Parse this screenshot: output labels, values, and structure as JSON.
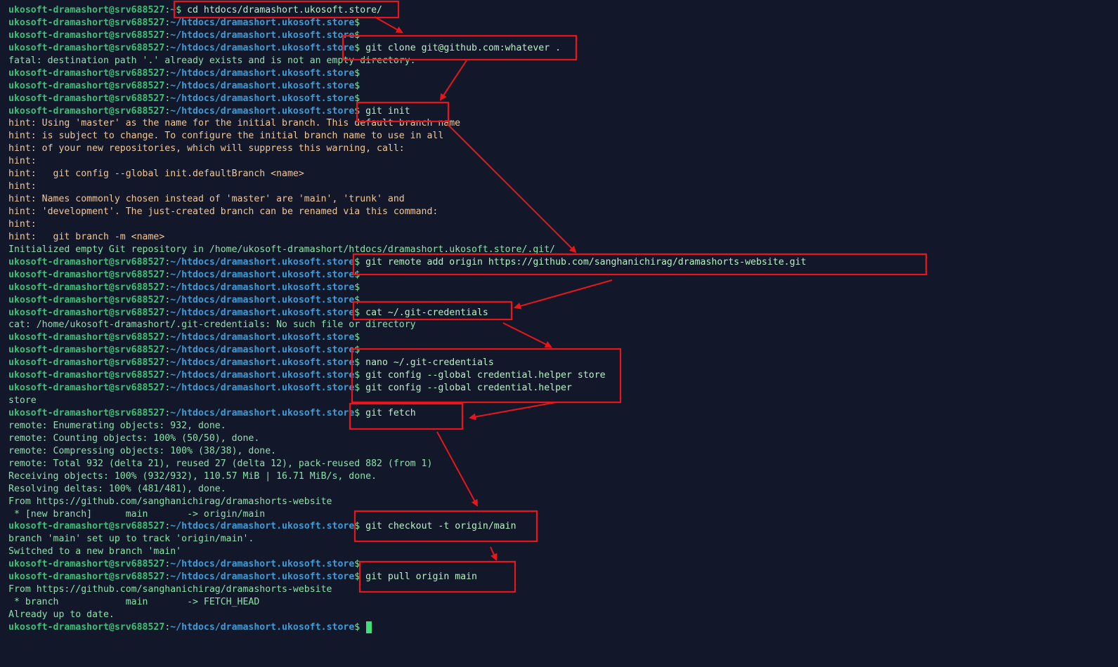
{
  "terminal": {
    "prompt": {
      "user": "ukosoft-dramashort@srv688527",
      "separator": ":",
      "dollar": "$",
      "home_path": "~",
      "project_path": "~/htdocs/dramashort.ukosoft.store"
    },
    "lines": [
      {
        "kind": "prompt",
        "path": "~",
        "cmd": " cd htdocs/dramashort.ukosoft.store/"
      },
      {
        "kind": "prompt",
        "path": "~/htdocs/dramashort.ukosoft.store",
        "cmd": ""
      },
      {
        "kind": "prompt",
        "path": "~/htdocs/dramashort.ukosoft.store",
        "cmd": ""
      },
      {
        "kind": "prompt",
        "path": "~/htdocs/dramashort.ukosoft.store",
        "cmd": " git clone git@github.com:whatever ."
      },
      {
        "kind": "out",
        "text": "fatal: destination path '.' already exists and is not an empty directory."
      },
      {
        "kind": "prompt",
        "path": "~/htdocs/dramashort.ukosoft.store",
        "cmd": ""
      },
      {
        "kind": "prompt",
        "path": "~/htdocs/dramashort.ukosoft.store",
        "cmd": ""
      },
      {
        "kind": "prompt",
        "path": "~/htdocs/dramashort.ukosoft.store",
        "cmd": ""
      },
      {
        "kind": "prompt",
        "path": "~/htdocs/dramashort.ukosoft.store",
        "cmd": " git init"
      },
      {
        "kind": "hint",
        "text": "hint: Using 'master' as the name for the initial branch. This default branch name"
      },
      {
        "kind": "hint",
        "text": "hint: is subject to change. To configure the initial branch name to use in all"
      },
      {
        "kind": "hint",
        "text": "hint: of your new repositories, which will suppress this warning, call:"
      },
      {
        "kind": "hint",
        "text": "hint:"
      },
      {
        "kind": "hint",
        "text": "hint:   git config --global init.defaultBranch <name>"
      },
      {
        "kind": "hint",
        "text": "hint:"
      },
      {
        "kind": "hint",
        "text": "hint: Names commonly chosen instead of 'master' are 'main', 'trunk' and"
      },
      {
        "kind": "hint",
        "text": "hint: 'development'. The just-created branch can be renamed via this command:"
      },
      {
        "kind": "hint",
        "text": "hint:"
      },
      {
        "kind": "hint",
        "text": "hint:   git branch -m <name>"
      },
      {
        "kind": "out",
        "text": "Initialized empty Git repository in /home/ukosoft-dramashort/htdocs/dramashort.ukosoft.store/.git/"
      },
      {
        "kind": "prompt",
        "path": "~/htdocs/dramashort.ukosoft.store",
        "cmd": " git remote add origin https://github.com/sanghanichirag/dramashorts-website.git"
      },
      {
        "kind": "prompt",
        "path": "~/htdocs/dramashort.ukosoft.store",
        "cmd": ""
      },
      {
        "kind": "prompt",
        "path": "~/htdocs/dramashort.ukosoft.store",
        "cmd": ""
      },
      {
        "kind": "prompt",
        "path": "~/htdocs/dramashort.ukosoft.store",
        "cmd": ""
      },
      {
        "kind": "prompt",
        "path": "~/htdocs/dramashort.ukosoft.store",
        "cmd": " cat ~/.git-credentials"
      },
      {
        "kind": "out",
        "text": "cat: /home/ukosoft-dramashort/.git-credentials: No such file or directory"
      },
      {
        "kind": "prompt",
        "path": "~/htdocs/dramashort.ukosoft.store",
        "cmd": ""
      },
      {
        "kind": "prompt",
        "path": "~/htdocs/dramashort.ukosoft.store",
        "cmd": ""
      },
      {
        "kind": "prompt",
        "path": "~/htdocs/dramashort.ukosoft.store",
        "cmd": " nano ~/.git-credentials"
      },
      {
        "kind": "prompt",
        "path": "~/htdocs/dramashort.ukosoft.store",
        "cmd": " git config --global credential.helper store"
      },
      {
        "kind": "prompt",
        "path": "~/htdocs/dramashort.ukosoft.store",
        "cmd": " git config --global credential.helper"
      },
      {
        "kind": "out",
        "text": "store"
      },
      {
        "kind": "prompt",
        "path": "~/htdocs/dramashort.ukosoft.store",
        "cmd": " git fetch"
      },
      {
        "kind": "out",
        "text": "remote: Enumerating objects: 932, done."
      },
      {
        "kind": "out",
        "text": "remote: Counting objects: 100% (50/50), done."
      },
      {
        "kind": "out",
        "text": "remote: Compressing objects: 100% (38/38), done."
      },
      {
        "kind": "out",
        "text": "remote: Total 932 (delta 21), reused 27 (delta 12), pack-reused 882 (from 1)"
      },
      {
        "kind": "out",
        "text": "Receiving objects: 100% (932/932), 110.57 MiB | 16.71 MiB/s, done."
      },
      {
        "kind": "out",
        "text": "Resolving deltas: 100% (481/481), done."
      },
      {
        "kind": "out",
        "text": "From https://github.com/sanghanichirag/dramashorts-website"
      },
      {
        "kind": "out",
        "text": " * [new branch]      main       -> origin/main"
      },
      {
        "kind": "prompt",
        "path": "~/htdocs/dramashort.ukosoft.store",
        "cmd": " git checkout -t origin/main"
      },
      {
        "kind": "out",
        "text": "branch 'main' set up to track 'origin/main'."
      },
      {
        "kind": "out",
        "text": "Switched to a new branch 'main'"
      },
      {
        "kind": "prompt",
        "path": "~/htdocs/dramashort.ukosoft.store",
        "cmd": ""
      },
      {
        "kind": "prompt",
        "path": "~/htdocs/dramashort.ukosoft.store",
        "cmd": " git pull origin main"
      },
      {
        "kind": "out",
        "text": "From https://github.com/sanghanichirag/dramashorts-website"
      },
      {
        "kind": "out",
        "text": " * branch            main       -> FETCH_HEAD"
      },
      {
        "kind": "out",
        "text": "Already up to date."
      },
      {
        "kind": "prompt",
        "path": "~/htdocs/dramashort.ukosoft.store",
        "cmd": " ",
        "cursor": true
      }
    ]
  },
  "colors": {
    "background": "#121829",
    "annotation": "#e8161b",
    "user": "#3fbf78",
    "path": "#3f9bd6",
    "hint": "#f0c79a",
    "output": "#8be1a8",
    "cursor": "#3fe07a"
  }
}
